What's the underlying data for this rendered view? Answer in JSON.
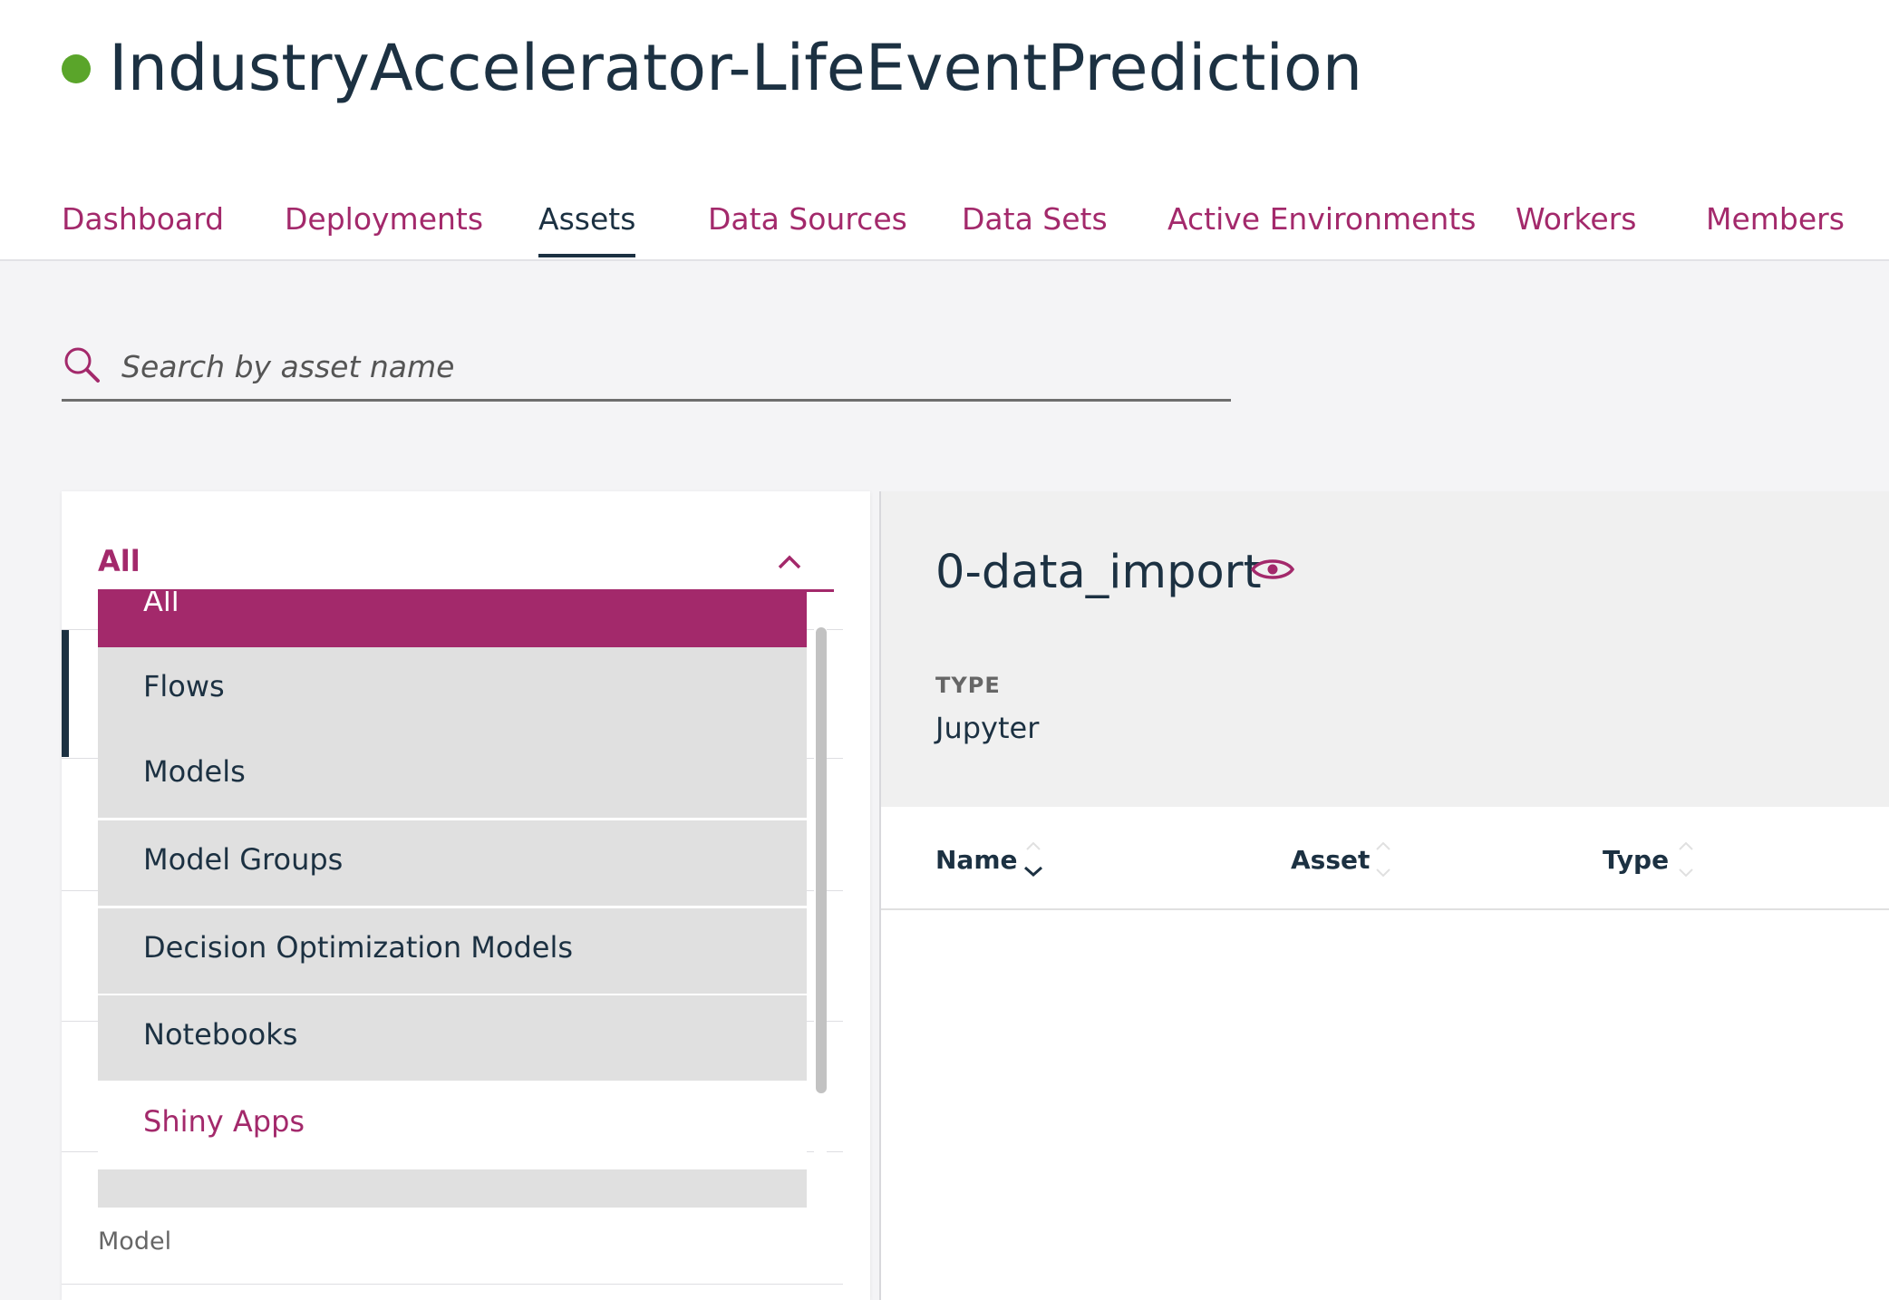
{
  "project": {
    "title": "IndustryAccelerator-LifeEventPrediction",
    "status_color": "#5aa52a"
  },
  "tabs": [
    {
      "label": "Dashboard"
    },
    {
      "label": "Deployments"
    },
    {
      "label": "Assets",
      "active": true
    },
    {
      "label": "Data Sources"
    },
    {
      "label": "Data Sets"
    },
    {
      "label": "Active Environments"
    },
    {
      "label": "Workers"
    },
    {
      "label": "Members"
    }
  ],
  "search": {
    "placeholder": "Search by asset name",
    "value": ""
  },
  "filter": {
    "selected_label": "All",
    "options": [
      {
        "label": "All",
        "state": "selected"
      },
      {
        "label": "Flows"
      },
      {
        "label": "Models"
      },
      {
        "label": "Model Groups"
      },
      {
        "label": "Decision Optimization Models"
      },
      {
        "label": "Notebooks"
      },
      {
        "label": "Shiny Apps",
        "state": "hover"
      }
    ]
  },
  "asset_list": {
    "visible_row_type": "Model"
  },
  "detail": {
    "name": "0-data_import",
    "type_heading": "TYPE",
    "type_value": "Jupyter",
    "columns": [
      "Name",
      "Asset",
      "Type"
    ]
  },
  "colors": {
    "accent": "#a3296b",
    "text": "#1c3142",
    "status_green": "#5aa52a"
  }
}
